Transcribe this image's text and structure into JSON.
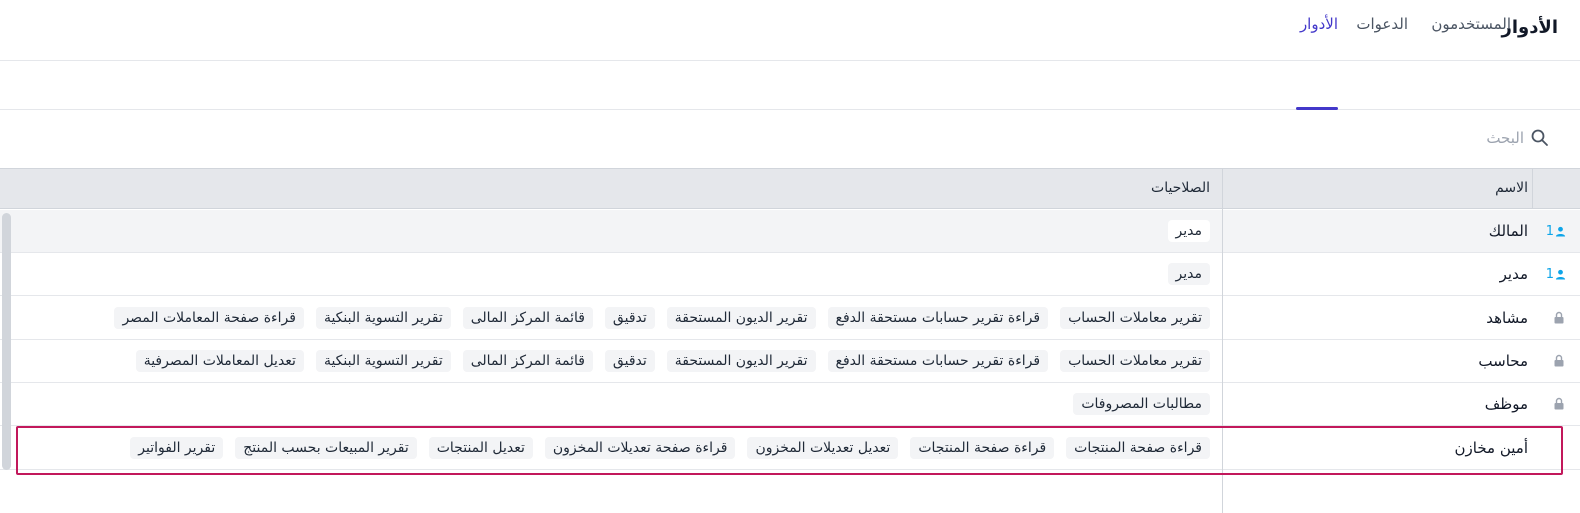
{
  "page": {
    "title": "الأدوار"
  },
  "tabs": [
    {
      "label": "المستخدمون",
      "active": false
    },
    {
      "label": "الدعوات",
      "active": false
    },
    {
      "label": "الأدوار",
      "active": true
    }
  ],
  "search": {
    "placeholder": "البحث",
    "value": "",
    "icon": "search-icon"
  },
  "table": {
    "columns": {
      "name": "الاسم",
      "permissions": "الصلاحيات"
    },
    "rows": [
      {
        "name": "المالك",
        "icon": "user-icon",
        "user_count": "1",
        "permissions": [
          "مدير"
        ]
      },
      {
        "name": "مدير",
        "icon": "user-icon",
        "user_count": "1",
        "permissions": [
          "مدير"
        ]
      },
      {
        "name": "مشاهد",
        "icon": "lock-icon",
        "permissions": [
          "تقرير معاملات الحساب",
          "قراءة تقرير حسابات مستحقة الدفع",
          "تقرير الديون المستحقة",
          "تدقيق",
          "قائمة المركز المالى",
          "تقرير التسوية البنكية",
          "قراءة صفحة المعاملات المصر"
        ]
      },
      {
        "name": "محاسب",
        "icon": "lock-icon",
        "permissions": [
          "تقرير معاملات الحساب",
          "قراءة تقرير حسابات مستحقة الدفع",
          "تقرير الديون المستحقة",
          "تدقيق",
          "قائمة المركز المالى",
          "تقرير التسوية البنكية",
          "تعديل المعاملات المصرفية"
        ]
      },
      {
        "name": "موظف",
        "icon": "lock-icon",
        "permissions": [
          "مطالبات المصروفات"
        ]
      },
      {
        "name": "أمين مخازن",
        "icon": "",
        "highlighted": true,
        "permissions": [
          "قراءة صفحة المنتجات",
          "قراءة صفحة المنتجات",
          "تعديل تعديلات المخزون",
          "قراءة صفحة تعديلات المخزون",
          "تعديل المنتجات",
          "تقرير المبيعات بحسب المنتج",
          "تقرير الفواتير"
        ]
      }
    ]
  },
  "colors": {
    "accent": "#4338ca",
    "highlight_border": "#c2185b",
    "user_icon": "#0ea5e9",
    "lock_icon": "#9ca3af"
  }
}
